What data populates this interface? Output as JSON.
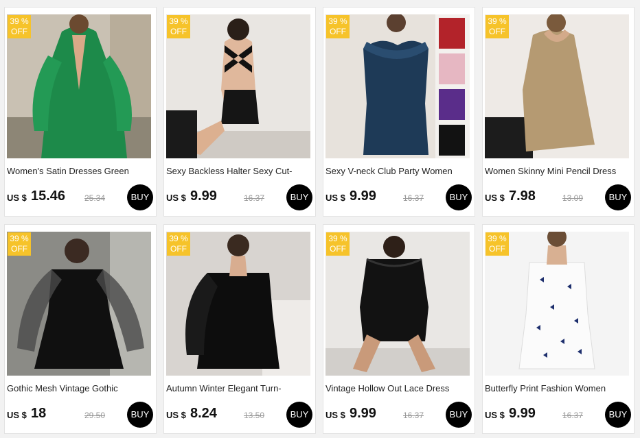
{
  "products": [
    {
      "badge_pct": "39 %",
      "badge_off": "OFF",
      "title": "Women's Satin Dresses Green",
      "currency": "US $",
      "price": "15.46",
      "old_price": "25.34",
      "buy_label": "BUY"
    },
    {
      "badge_pct": "39 %",
      "badge_off": "OFF",
      "title": "Sexy Backless Halter Sexy Cut-",
      "currency": "US $",
      "price": "9.99",
      "old_price": "16.37",
      "buy_label": "BUY"
    },
    {
      "badge_pct": "39 %",
      "badge_off": "OFF",
      "title": "Sexy V-neck Club Party Women",
      "currency": "US $",
      "price": "9.99",
      "old_price": "16.37",
      "buy_label": "BUY"
    },
    {
      "badge_pct": "39 %",
      "badge_off": "OFF",
      "title": "Women Skinny Mini Pencil Dress",
      "currency": "US $",
      "price": "7.98",
      "old_price": "13.09",
      "buy_label": "BUY"
    },
    {
      "badge_pct": "39 %",
      "badge_off": "OFF",
      "title": "Gothic Mesh Vintage Gothic",
      "currency": "US $",
      "price": "18",
      "old_price": "29.50",
      "buy_label": "BUY"
    },
    {
      "badge_pct": "39 %",
      "badge_off": "OFF",
      "title": "Autumn Winter Elegant Turn-",
      "currency": "US $",
      "price": "8.24",
      "old_price": "13.50",
      "buy_label": "BUY"
    },
    {
      "badge_pct": "39 %",
      "badge_off": "OFF",
      "title": "Vintage Hollow Out Lace Dress",
      "currency": "US $",
      "price": "9.99",
      "old_price": "16.37",
      "buy_label": "BUY"
    },
    {
      "badge_pct": "39 %",
      "badge_off": "OFF",
      "title": "Butterfly Print Fashion Women",
      "currency": "US $",
      "price": "9.99",
      "old_price": "16.37",
      "buy_label": "BUY"
    }
  ],
  "colors": {
    "badge": "#f6c32a",
    "buy_button": "#000000",
    "old_price": "#999999"
  }
}
